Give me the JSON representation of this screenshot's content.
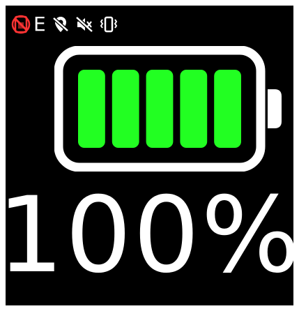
{
  "status_bar": {
    "network_type": "E",
    "icons": [
      "no-sim-icon",
      "location-off-icon",
      "mute-icon",
      "vibrate-icon"
    ]
  },
  "battery": {
    "level_percent": 100,
    "label": "100%",
    "segments_total": 5,
    "segments_filled": 5,
    "fill_color": "#22ff22",
    "outline_color": "#ffffff"
  },
  "colors": {
    "background": "#000000",
    "foreground": "#ffffff",
    "alert": "#ff3333"
  }
}
